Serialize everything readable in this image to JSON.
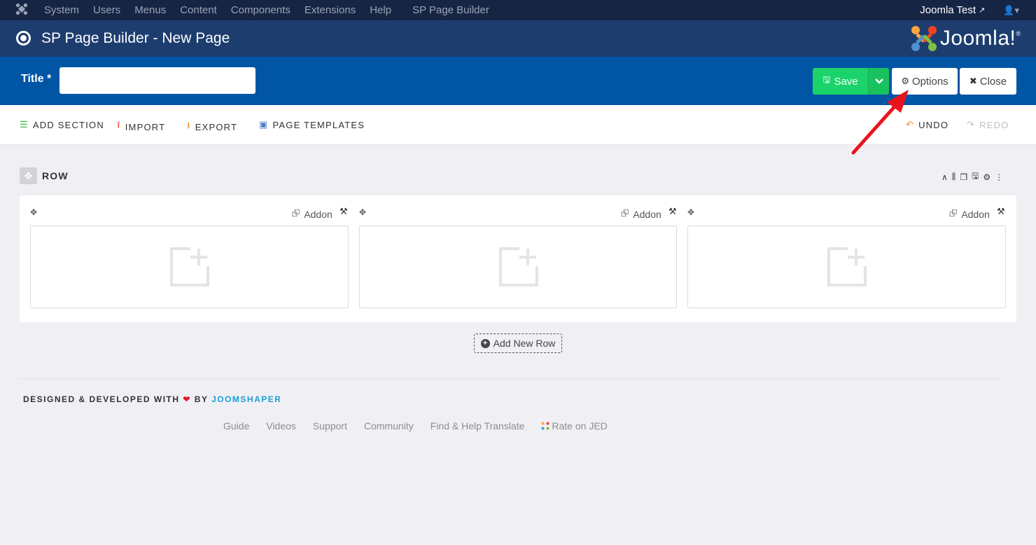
{
  "topnav": {
    "menu": [
      "System",
      "Users",
      "Menus",
      "Content",
      "Components",
      "Extensions",
      "Help"
    ],
    "component": "SP Page Builder",
    "site_link": "Joomla Test"
  },
  "header": {
    "title": "SP Page Builder - New Page",
    "brand": "Joomla!"
  },
  "titlebar": {
    "label": "Title *",
    "title_value": "",
    "save_label": "Save",
    "options_label": "Options",
    "close_label": "Close"
  },
  "toolbar": {
    "add_section": "ADD SECTION",
    "import": "IMPORT",
    "export": "EXPORT",
    "page_templates": "PAGE TEMPLATES",
    "undo": "UNDO",
    "redo": "REDO"
  },
  "row": {
    "title": "ROW",
    "columns": [
      {
        "addon_label": "Addon"
      },
      {
        "addon_label": "Addon"
      },
      {
        "addon_label": "Addon"
      }
    ],
    "add_row_label": "Add New Row"
  },
  "footer": {
    "credit_prefix": "DESIGNED & DEVELOPED WITH",
    "credit_by": "BY",
    "credit_brand": "JOOMSHAPER",
    "links": [
      "Guide",
      "Videos",
      "Support",
      "Community",
      "Find & Help Translate",
      "Rate on JED"
    ]
  },
  "colors": {
    "topnav_bg": "#162544",
    "header_bg": "#1c3d6e",
    "titlebar_bg": "#0055a5",
    "save_green": "#1ad36a",
    "annotation_red": "#e8141c",
    "brand_blue": "#1a9fd9"
  }
}
